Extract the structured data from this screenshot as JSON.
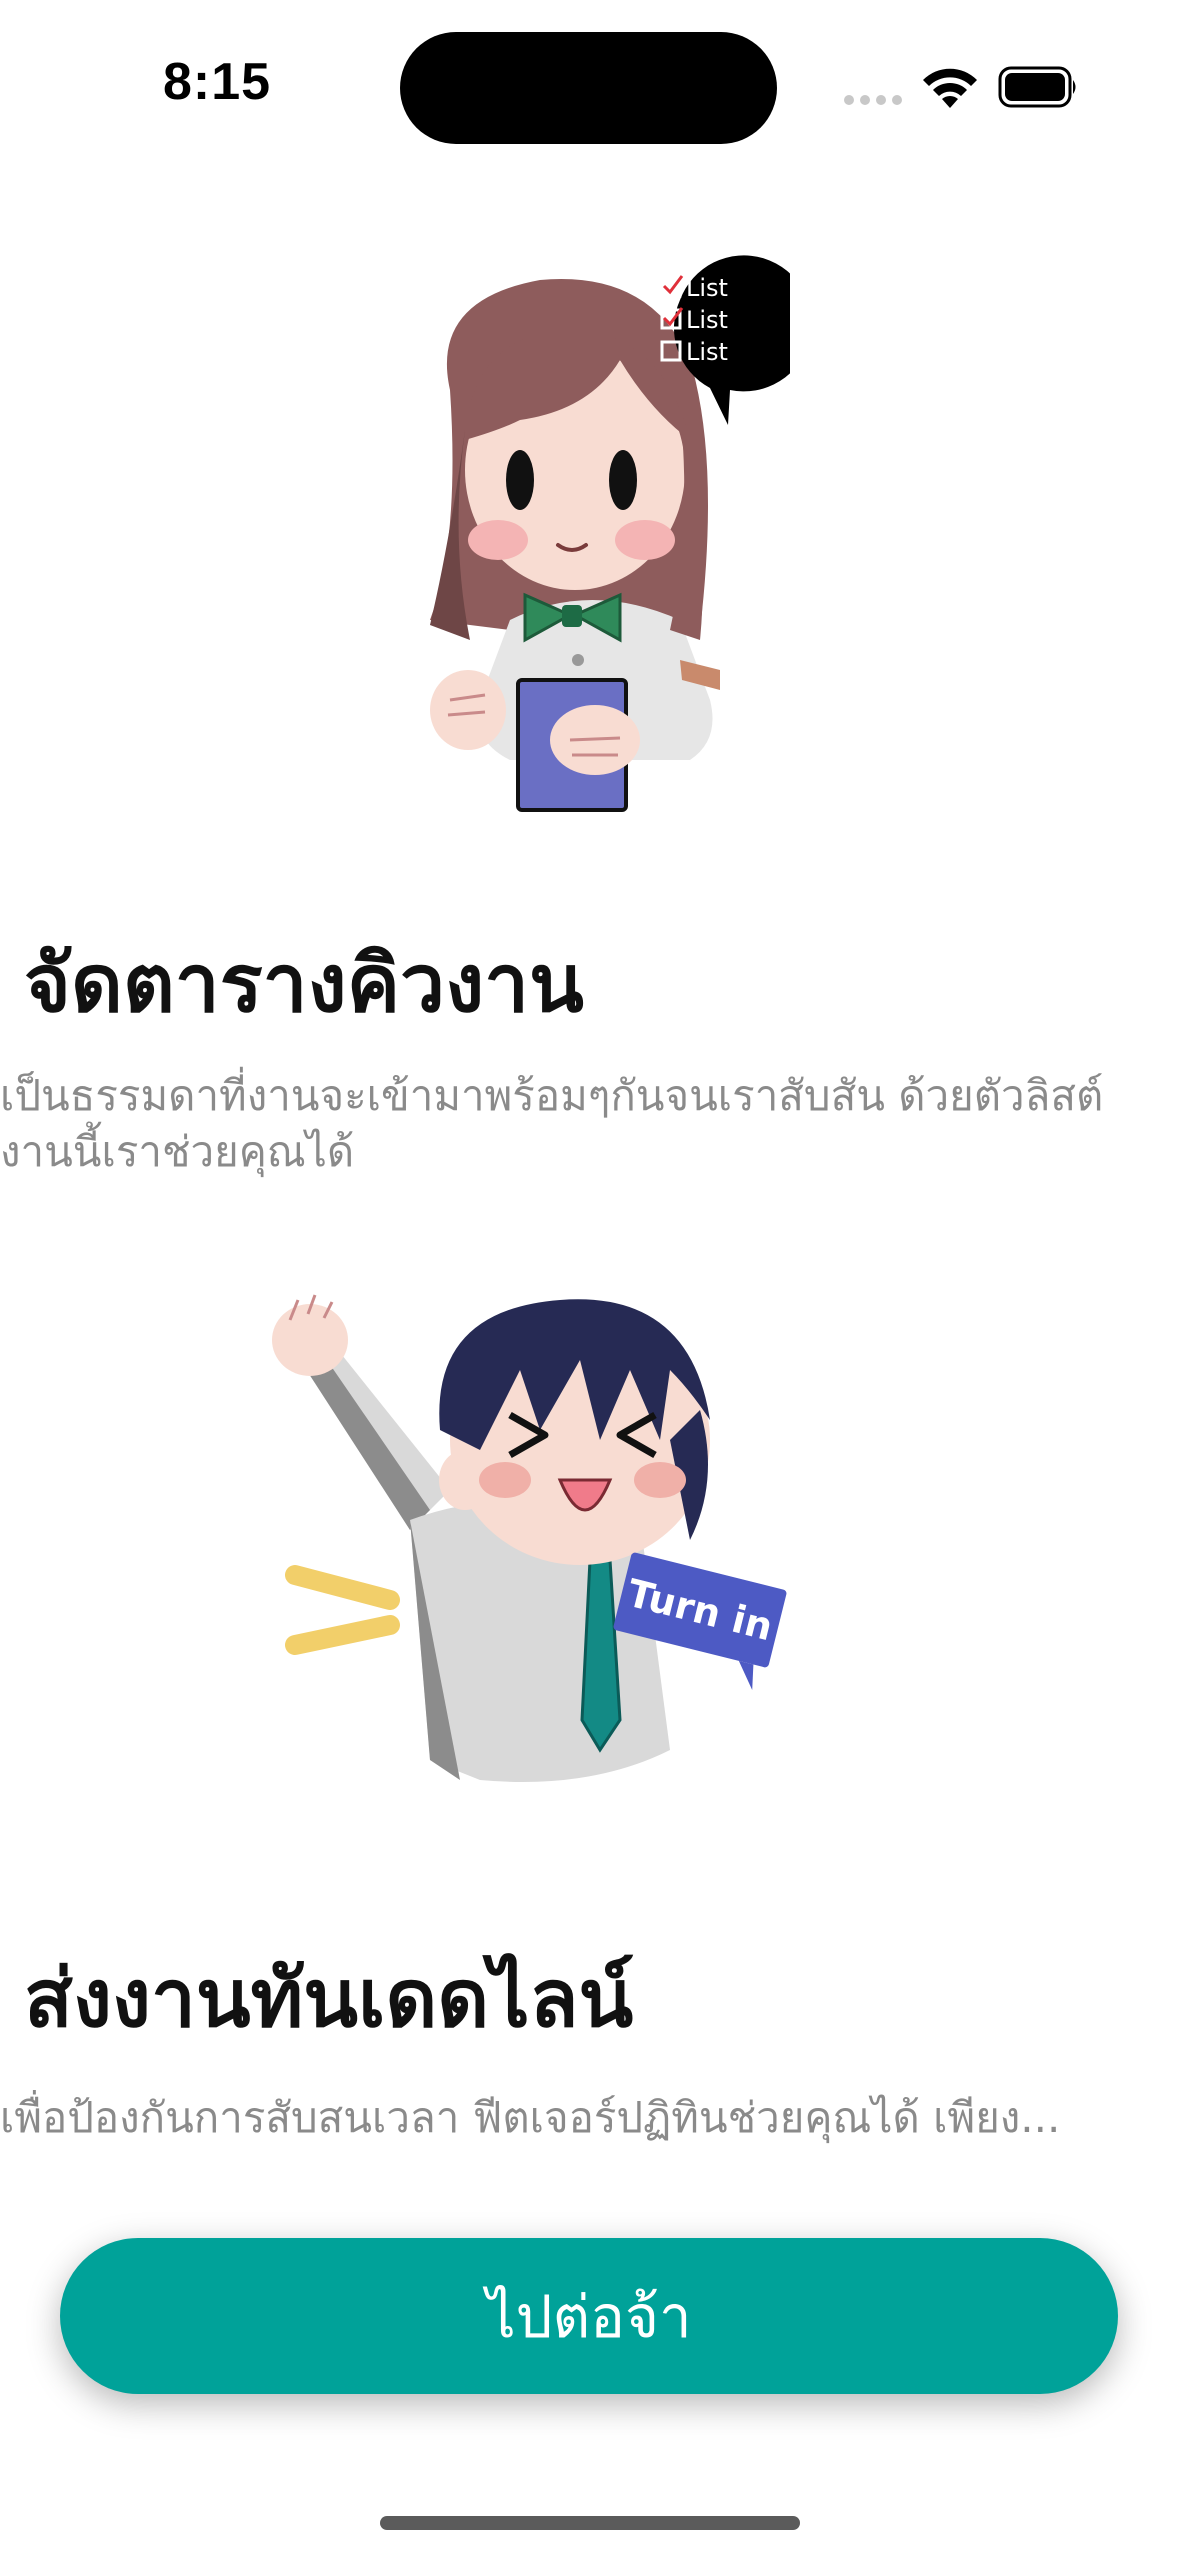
{
  "status_bar": {
    "time": "8:15",
    "icons": [
      "cellular-signal-icon",
      "wifi-icon",
      "battery-icon"
    ]
  },
  "features": [
    {
      "title": "จัดตารางคิวงาน",
      "description": "เป็นธรรมดาที่งานจะเข้ามาพร้อมๆกันจนเราสับสัน ด้วยตัวลิสต์งานนี้เราช่วยคุณได้",
      "illustration": "girl-holding-checklist",
      "illustration_text": [
        "List",
        "List",
        "List"
      ]
    },
    {
      "title": "ส่งงานทันเดดไลน์",
      "description": "เพื่อป้องกันการสับสนเวลา ฟีตเจอร์ปฏิทินช่วยคุณได้ เพียง...",
      "illustration": "boy-cheering-turn-in",
      "illustration_text": [
        "Turn in"
      ]
    }
  ],
  "continue_button": {
    "label": "ไปต่อจ้า"
  },
  "colors": {
    "accent": "#00a299",
    "title_text": "#111111",
    "description_text": "#8a8a8a"
  }
}
